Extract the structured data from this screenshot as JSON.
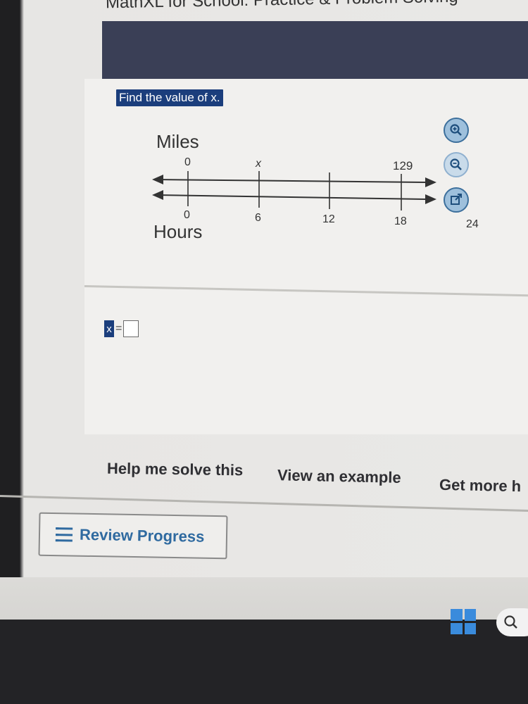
{
  "window": {
    "title": "MathXL for School: Practice & Problem Solving"
  },
  "problem": {
    "prompt": "Find the value of x.",
    "answer_variable": "x",
    "equals": "=",
    "answer_value": ""
  },
  "diagram": {
    "top_label": "Miles",
    "bottom_label": "Hours",
    "top_ticks": [
      "0",
      "x",
      "",
      "129"
    ],
    "bottom_ticks": [
      "0",
      "6",
      "12",
      "18",
      "24"
    ]
  },
  "tools": {
    "zoom_in": "zoom-in-icon",
    "zoom_out": "zoom-out-icon",
    "popout": "popout-icon"
  },
  "help": {
    "help_me_solve": "Help me solve this",
    "view_example": "View an example",
    "get_more_help": "Get more h"
  },
  "review": {
    "label": "Review Progress"
  },
  "colors": {
    "header": "#3a3f56",
    "highlight": "#1b3e7c",
    "link": "#2f6aa0"
  }
}
